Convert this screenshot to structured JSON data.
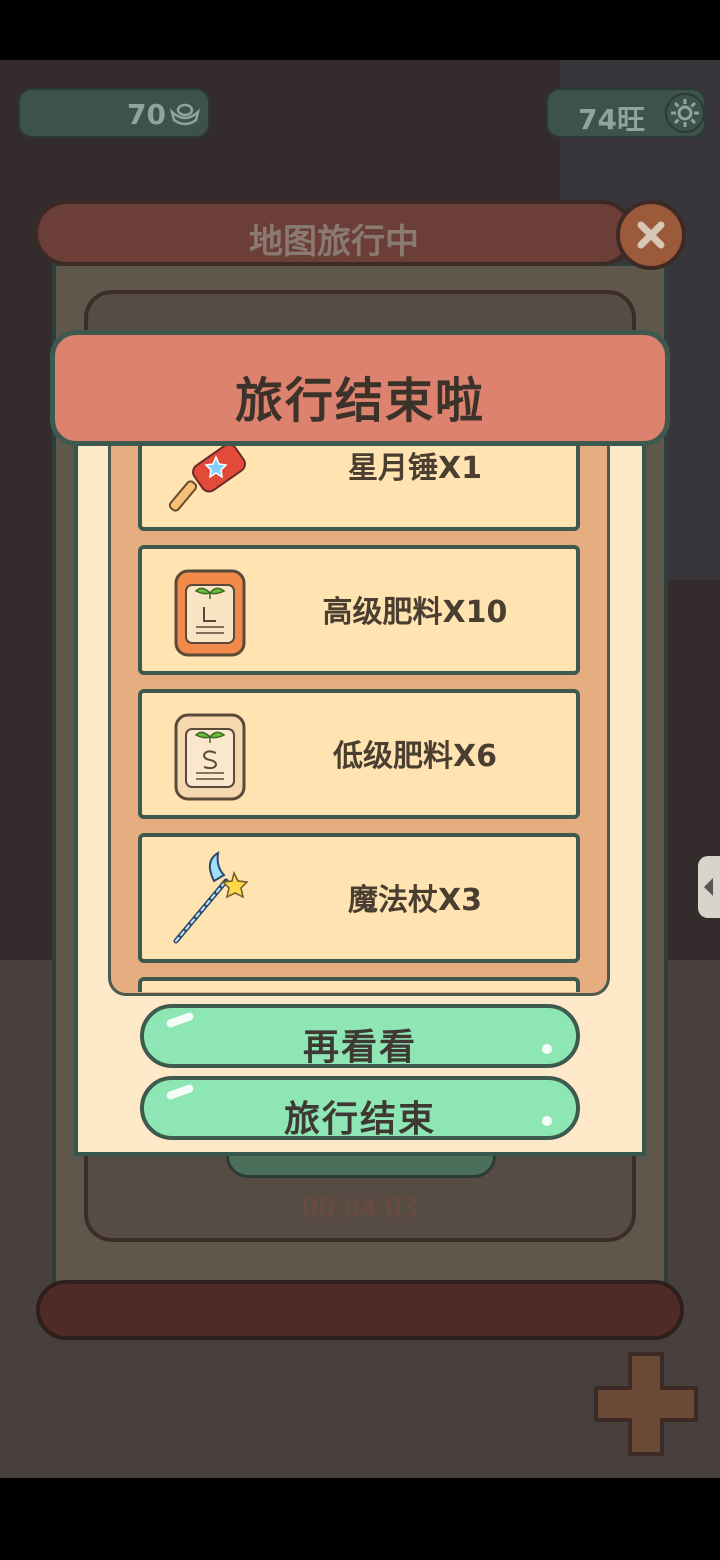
{
  "hud": {
    "currency_value": "70",
    "currency_icon": "gold-ingot-icon",
    "wang_value": "74旺",
    "settings_icon": "gear-icon"
  },
  "travel_panel": {
    "title": "地图旅行中",
    "timer": "00:04:03",
    "close_icon": "close-icon"
  },
  "popup": {
    "title": "旅行结束啦",
    "items": [
      {
        "name": "星月锤X1",
        "icon": "star-moon-hammer-icon"
      },
      {
        "name": "高级肥料X10",
        "icon": "premium-fertilizer-bag-icon"
      },
      {
        "name": "低级肥料X6",
        "icon": "basic-fertilizer-bag-icon"
      },
      {
        "name": "魔法杖X3",
        "icon": "magic-wand-icon"
      }
    ],
    "buttons": {
      "look_again": "再看看",
      "end_travel": "旅行结束"
    }
  },
  "colors": {
    "banner": "#de8270",
    "popup_bg": "#fde9c8",
    "list_bg": "#e5ad80",
    "item_bg": "#ffe4b2",
    "button_green": "#8ee6b4",
    "outline": "#3e5a4f"
  }
}
